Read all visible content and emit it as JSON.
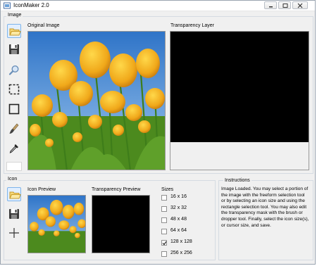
{
  "window": {
    "title": "IconMaker 2.0"
  },
  "image_group": {
    "label": "Image",
    "original_label": "Original Image",
    "transparency_label": "Transparency Layer"
  },
  "icon_group": {
    "label": "Icon",
    "preview_label": "Icon Preview",
    "transparency_preview_label": "Transparency Preview",
    "sizes_label": "Sizes",
    "sizes": [
      {
        "label": "16 x 16",
        "checked": false
      },
      {
        "label": "32 x 32",
        "checked": false
      },
      {
        "label": "48 x 48",
        "checked": false
      },
      {
        "label": "64 x 64",
        "checked": false
      },
      {
        "label": "128 x 128",
        "checked": true
      },
      {
        "label": "256 x 256",
        "checked": false
      }
    ]
  },
  "instructions": {
    "title": "Instructions",
    "text": "Image Loaded. You may select a portion of the image with the freeform selection tool or by selecting an icon size and using the rectangle selection tool. You may also edit the transparency mask with the brush or dropper tool. Finally, select the icon size(s), or cursor size, and save."
  },
  "tools": [
    "open-folder-icon",
    "save-icon",
    "zoom-icon",
    "freeform-select-icon",
    "rectangle-select-icon",
    "brush-icon",
    "dropper-icon"
  ],
  "icon_tools": [
    "open-folder-icon",
    "save-icon",
    "crosshair-icon"
  ]
}
